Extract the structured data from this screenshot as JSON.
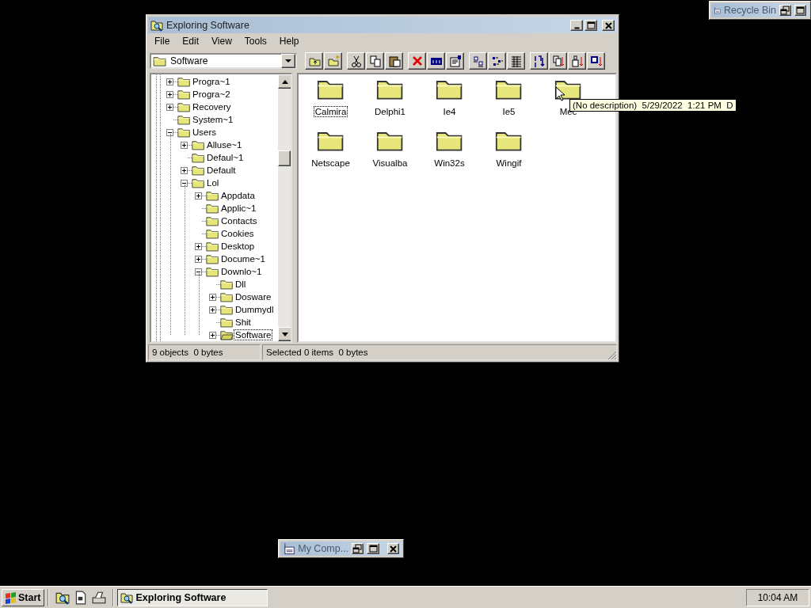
{
  "window": {
    "title": "Exploring Software"
  },
  "menu": [
    "File",
    "Edit",
    "View",
    "Tools",
    "Help"
  ],
  "address": {
    "value": "Software"
  },
  "tree": [
    {
      "label": "Progra~1",
      "has_children": true,
      "expanded": false,
      "selected": false
    },
    {
      "label": "Progra~2",
      "has_children": true,
      "expanded": false,
      "selected": false
    },
    {
      "label": "Recovery",
      "has_children": true,
      "expanded": false,
      "selected": false
    },
    {
      "label": "System~1",
      "has_children": false,
      "expanded": false,
      "selected": false
    },
    {
      "label": "Users",
      "has_children": true,
      "expanded": true,
      "selected": false,
      "children": [
        {
          "label": "Alluse~1",
          "has_children": true,
          "expanded": false,
          "selected": false
        },
        {
          "label": "Defaul~1",
          "has_children": false,
          "expanded": false,
          "selected": false
        },
        {
          "label": "Default",
          "has_children": true,
          "expanded": false,
          "selected": false
        },
        {
          "label": "Lol",
          "has_children": true,
          "expanded": true,
          "selected": false,
          "children": [
            {
              "label": "Appdata",
              "has_children": true,
              "expanded": false,
              "selected": false
            },
            {
              "label": "Applic~1",
              "has_children": false,
              "expanded": false,
              "selected": false
            },
            {
              "label": "Contacts",
              "has_children": false,
              "expanded": false,
              "selected": false
            },
            {
              "label": "Cookies",
              "has_children": false,
              "expanded": false,
              "selected": false
            },
            {
              "label": "Desktop",
              "has_children": true,
              "expanded": false,
              "selected": false
            },
            {
              "label": "Docume~1",
              "has_children": true,
              "expanded": false,
              "selected": false
            },
            {
              "label": "Downlo~1",
              "has_children": true,
              "expanded": true,
              "selected": false,
              "children": [
                {
                  "label": "Dll",
                  "has_children": false,
                  "expanded": false,
                  "selected": false
                },
                {
                  "label": "Dosware",
                  "has_children": true,
                  "expanded": false,
                  "selected": false
                },
                {
                  "label": "Dummydl",
                  "has_children": true,
                  "expanded": false,
                  "selected": false
                },
                {
                  "label": "Shit",
                  "has_children": false,
                  "expanded": false,
                  "selected": false
                },
                {
                  "label": "Software",
                  "has_children": true,
                  "expanded": false,
                  "selected": true
                }
              ]
            }
          ]
        }
      ]
    }
  ],
  "folders": [
    {
      "label": "Calmira",
      "focused": true
    },
    {
      "label": "Delphi1",
      "focused": false
    },
    {
      "label": "Ie4",
      "focused": false
    },
    {
      "label": "Ie5",
      "focused": false
    },
    {
      "label": "Mec",
      "focused": false
    },
    {
      "label": "Netscape",
      "focused": false
    },
    {
      "label": "Visualba",
      "focused": false
    },
    {
      "label": "Win32s",
      "focused": false
    },
    {
      "label": "Wingif",
      "focused": false
    }
  ],
  "tooltip": "(No description)  5/29/2022  1:21 PM  D",
  "status_bar": [
    "9 objects  0 bytes",
    "Selected 0 items  0 bytes"
  ],
  "minimized_windows": [
    {
      "title": "My Comp..."
    },
    {
      "title": "Recycle Bin"
    }
  ],
  "taskbar": {
    "start": "Start",
    "tasks": [
      {
        "label": "Exploring Software",
        "selected": true
      }
    ],
    "clock": "10:04 AM"
  }
}
